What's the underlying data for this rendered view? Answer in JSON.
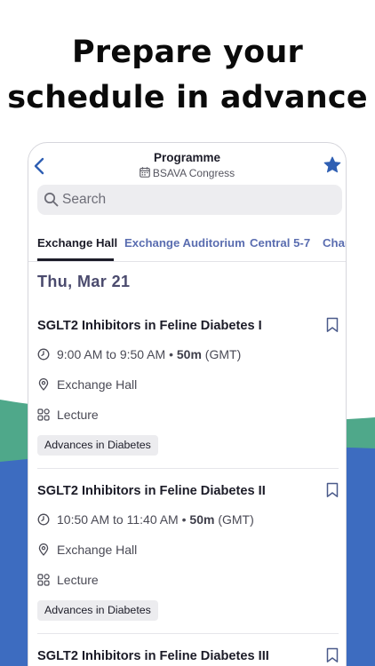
{
  "headline": {
    "line1": "Prepare your",
    "line2": "schedule in advance"
  },
  "colors": {
    "green_band": "#4fa88a",
    "blue_band": "#3d6cc0",
    "tab_inactive": "#5a6db0",
    "star": "#2f5fb3",
    "day_heading": "#4b4b6e"
  },
  "nav": {
    "back_icon": "chevron-left-icon",
    "title": "Programme",
    "calendar_icon": "calendar-icon",
    "subtitle": "BSAVA Congress",
    "favorite_icon": "star-icon"
  },
  "search": {
    "placeholder": "Search",
    "value": ""
  },
  "tabs": [
    {
      "label": "Exchange Hall",
      "active": true
    },
    {
      "label": "Exchange Auditorium",
      "active": false
    },
    {
      "label": "Central 5-7",
      "active": false
    },
    {
      "label": "Char",
      "active": false
    }
  ],
  "day_heading": "Thu, Mar 21",
  "sessions": [
    {
      "title": "SGLT2 Inhibitors in Feline Diabetes I",
      "time": "9:00 AM to 9:50 AM",
      "duration": "50m",
      "timezone": "(GMT)",
      "location": "Exchange Hall",
      "type": "Lecture",
      "tag": "Advances in Diabetes"
    },
    {
      "title": "SGLT2 Inhibitors in Feline Diabetes II",
      "time": "10:50 AM to 11:40 AM",
      "duration": "50m",
      "timezone": "(GMT)",
      "location": "Exchange Hall",
      "type": "Lecture",
      "tag": "Advances in Diabetes"
    },
    {
      "title": "SGLT2 Inhibitors in Feline Diabetes III"
    }
  ]
}
